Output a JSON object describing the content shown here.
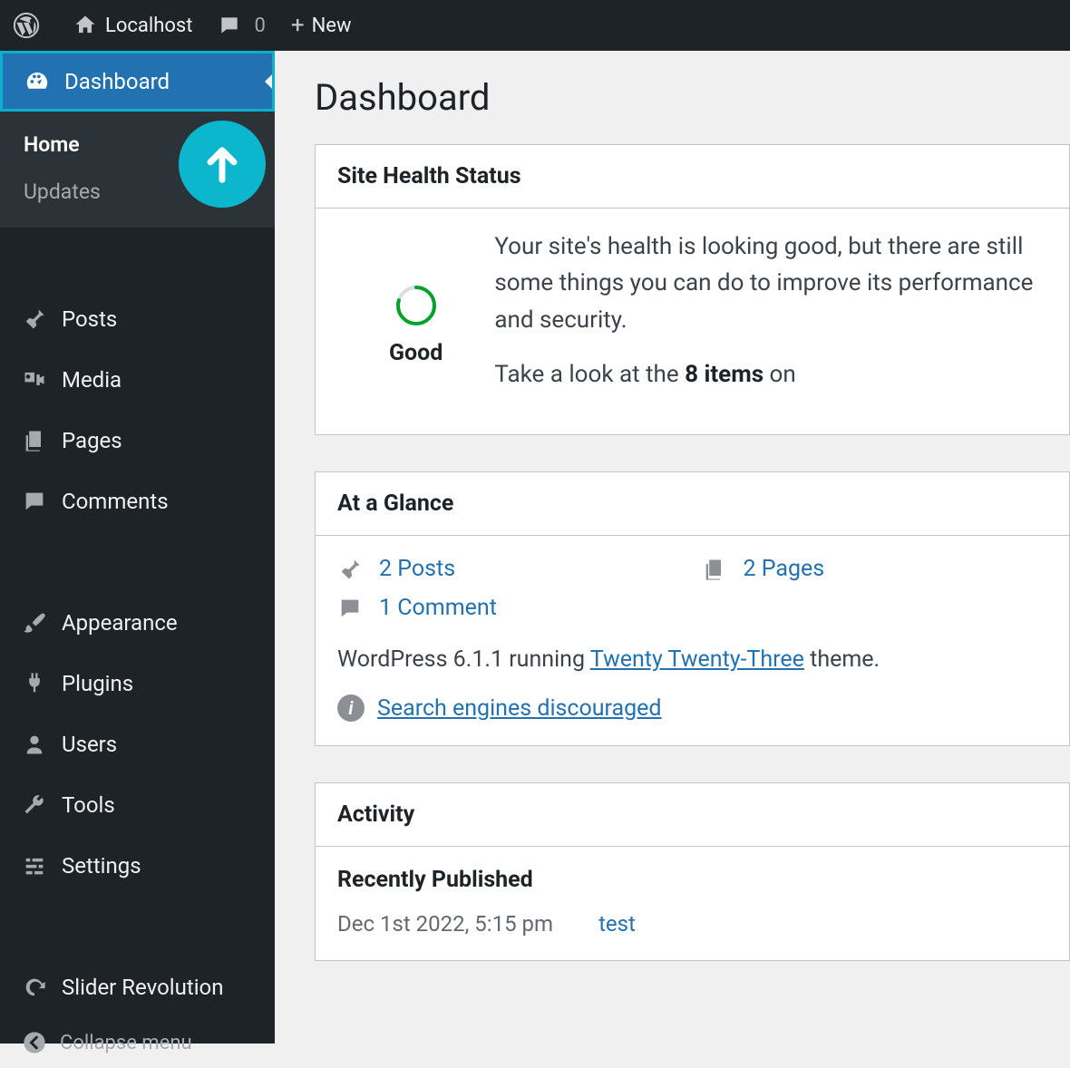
{
  "adminbar": {
    "site_name": "Localhost",
    "comments_count": "0",
    "new_label": "New"
  },
  "sidebar": {
    "dashboard": "Dashboard",
    "home": "Home",
    "updates": "Updates",
    "posts": "Posts",
    "media": "Media",
    "pages": "Pages",
    "comments": "Comments",
    "appearance": "Appearance",
    "plugins": "Plugins",
    "users": "Users",
    "tools": "Tools",
    "settings": "Settings",
    "slider_revolution": "Slider Revolution",
    "collapse": "Collapse menu"
  },
  "page": {
    "title": "Dashboard"
  },
  "site_health": {
    "heading": "Site Health Status",
    "status": "Good",
    "line1": "Your site's health is looking good, but there are still some things you can do to improve its performance and security.",
    "line2_prefix": "Take a look at the ",
    "line2_bold": "8 items",
    "line2_suffix": " on"
  },
  "glance": {
    "heading": "At a Glance",
    "posts": "2 Posts",
    "pages": "2 Pages",
    "comments": "1 Comment",
    "version_prefix": "WordPress 6.1.1 running ",
    "theme_link": "Twenty Twenty-Three",
    "version_suffix": " theme.",
    "seo": "Search engines discouraged"
  },
  "activity": {
    "heading": "Activity",
    "recent_heading": "Recently Published",
    "item_date": "Dec 1st 2022, 5:15 pm",
    "item_link": "test"
  }
}
